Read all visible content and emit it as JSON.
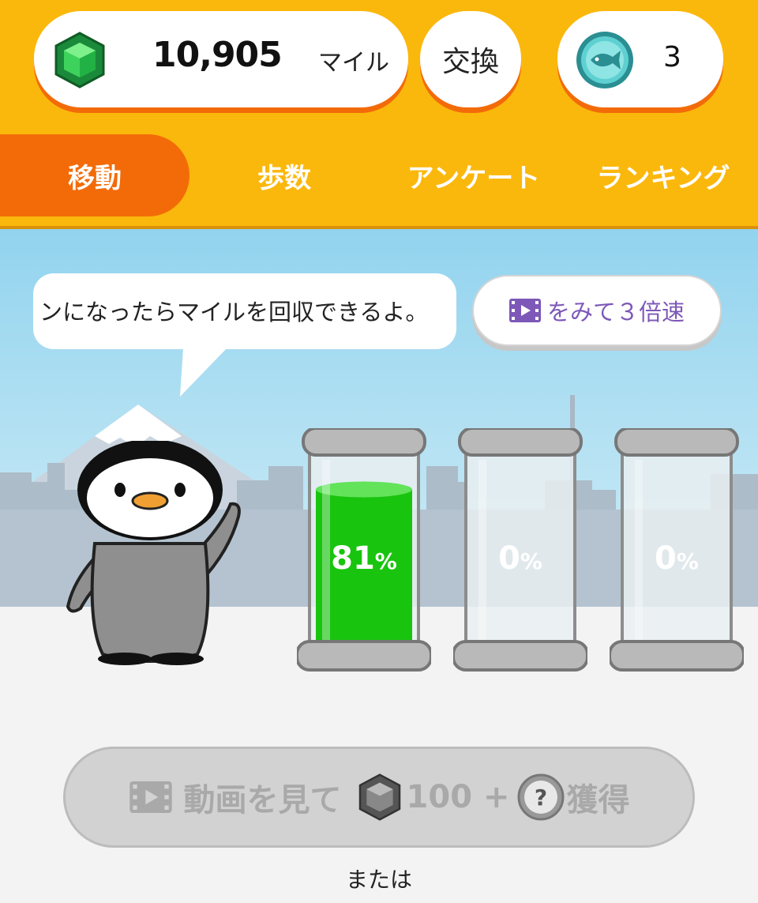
{
  "header": {
    "miles_value": "10,905",
    "miles_unit": "マイル",
    "exchange_label": "交換",
    "fish_coin_count": "3"
  },
  "tabs": [
    {
      "label": "移動",
      "active": true
    },
    {
      "label": "歩数",
      "active": false
    },
    {
      "label": "アンケート",
      "active": false
    },
    {
      "label": "ランキング",
      "active": false
    }
  ],
  "scene": {
    "speech_text": "ンになったらマイルを回収できるよ。",
    "speed_button_label": "をみて３倍速",
    "canisters": [
      {
        "percent": "81",
        "unit": "%",
        "fill": 0.81
      },
      {
        "percent": "0",
        "unit": "%",
        "fill": 0
      },
      {
        "percent": "0",
        "unit": "%",
        "fill": 0
      }
    ]
  },
  "bottom": {
    "video_label_1": "動画を見て",
    "video_amount": "100 +",
    "video_label_2": "獲得",
    "or_text": "または"
  },
  "colors": {
    "header_bg": "#fbb80c",
    "accent_orange": "#f36b08",
    "canister_green": "#19c40f",
    "speed_text": "#7d58b8"
  },
  "icons": [
    "gem-icon",
    "fish-coin-icon",
    "video-icon",
    "gem-gray-icon",
    "question-coin-icon"
  ]
}
